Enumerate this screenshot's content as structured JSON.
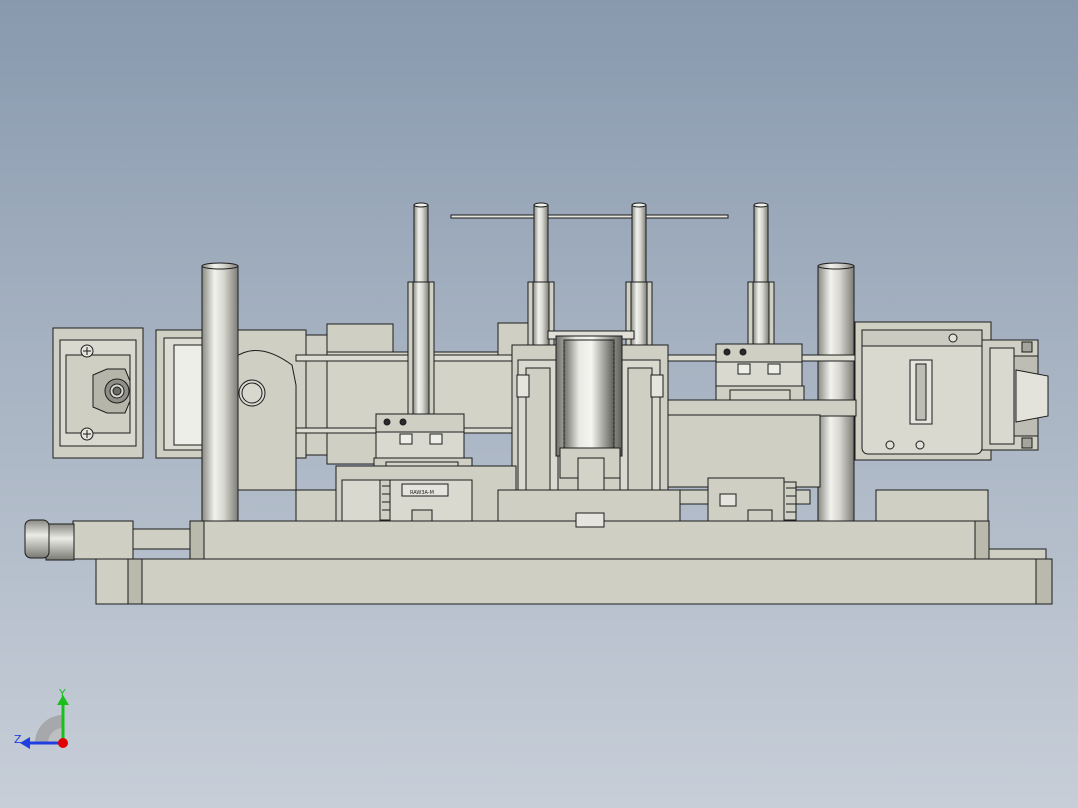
{
  "colors": {
    "background_top": "#8899ae",
    "background_bottom": "#c7ced8",
    "part_fill": "#cfcfc4",
    "part_shade": "#b9b9ac",
    "edge": "#1c1c1c",
    "rod_light": "#f2f2ee",
    "rod_dark": "#8a8a84",
    "axis_x": "#e00000",
    "axis_y": "#1bbf1b",
    "axis_z": "#1f3fe0"
  },
  "triad": {
    "y_label": "Y",
    "z_label": "Z"
  },
  "model_name": "assembly-front-view",
  "label_plate_text": "RAW3A-M"
}
